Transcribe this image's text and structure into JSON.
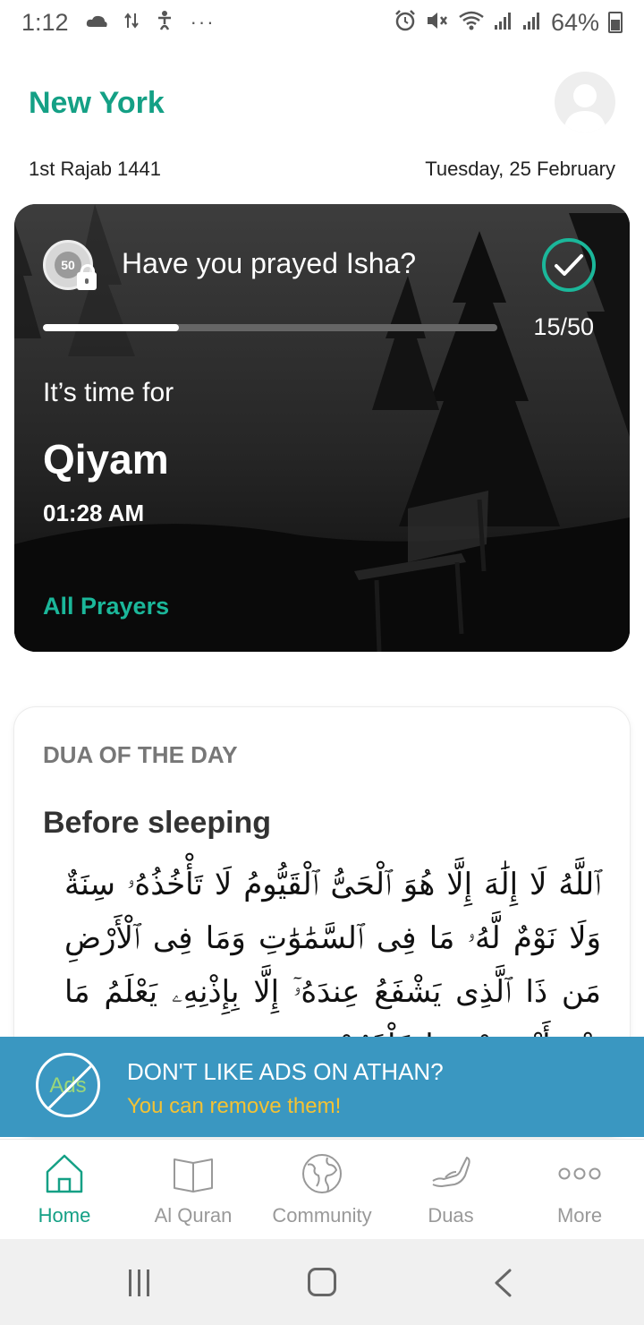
{
  "status_bar": {
    "time": "1:12",
    "battery": "64%",
    "more_glyph": "···"
  },
  "header": {
    "city": "New York",
    "hijri_date": "1st Rajab 1441",
    "gregorian_date": "Tuesday, 25 February"
  },
  "prayer_card": {
    "badge_number": "50",
    "question": "Have you prayed Isha?",
    "progress_label": "15/50",
    "progress_value": 15,
    "progress_max": 50,
    "time_for_label": "It’s time for",
    "prayer_name": "Qiyam",
    "prayer_time": "01:28 AM",
    "all_prayers_link": "All Prayers",
    "accent_color": "#1bb79a"
  },
  "dua_card": {
    "section_header": "DUA OF THE DAY",
    "title": "Before sleeping",
    "arabic_text": "ٱللَّهُ لَا إِلَٰهَ إِلَّا هُوَ ٱلْحَىُّ ٱلْقَيُّومُ لَا تَأْخُذُهُۥ سِنَةٌ وَلَا نَوْمٌ لَّهُۥ مَا فِى ٱلسَّمَٰوَٰتِ وَمَا فِى ٱلْأَرْضِ مَن ذَا ٱلَّذِى يَشْفَعُ عِندَهُۥٓ إِلَّا بِإِذْنِهِۦ يَعْلَمُ مَا بَيْنَ أَيْدِيهِمْ وَمَا خَلْفَهُمْ"
  },
  "ads_banner": {
    "icon_text": "Ads",
    "title": "DON'T LIKE ADS ON ATHAN?",
    "subtitle": "You can remove them!",
    "background_color": "#3a97c1",
    "subtitle_color": "#f4c233"
  },
  "bottom_nav": {
    "items": [
      {
        "label": "Home",
        "icon": "home-icon",
        "active": true
      },
      {
        "label": "Al Quran",
        "icon": "book-icon",
        "active": false
      },
      {
        "label": "Community",
        "icon": "globe-icon",
        "active": false
      },
      {
        "label": "Duas",
        "icon": "praying-hands-icon",
        "active": false
      },
      {
        "label": "More",
        "icon": "more-dots-icon",
        "active": false
      }
    ],
    "active_color": "#14a085",
    "inactive_color": "#999999"
  },
  "theme": {
    "brand_color": "#14a085"
  }
}
